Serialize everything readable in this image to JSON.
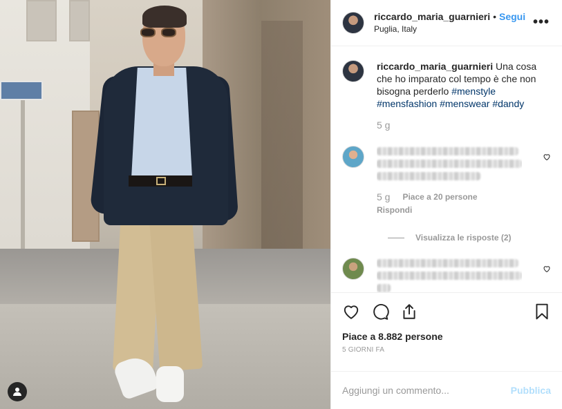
{
  "header": {
    "username": "riccardo_maria_guarnieri",
    "dot": "•",
    "follow_label": "Segui",
    "location": "Puglia, Italy",
    "more_label": "•••"
  },
  "caption": {
    "username": "riccardo_maria_guarnieri",
    "text": " Una cosa che ho imparato col tempo è che non bisogna perderlo ",
    "hashtags": [
      "#menstyle",
      "#mensfashion",
      "#menswear",
      "#dandy"
    ],
    "time": "5 g"
  },
  "comments": [
    {
      "time": "5 g",
      "likes": "Piace a 20 persone",
      "reply_label": "Rispondi",
      "view_replies": "Visualizza le risposte (2)"
    },
    {}
  ],
  "actions": {
    "like_icon": "heart-icon",
    "comment_icon": "comment-icon",
    "share_icon": "share-icon",
    "save_icon": "bookmark-icon"
  },
  "likes_text": "Piace a 8.882 persone",
  "posted_ago": "5 GIORNI FA",
  "add_comment": {
    "placeholder": "Aggiungi un commento...",
    "publish_label": "Pubblica"
  },
  "colors": {
    "accent": "#3897f0",
    "hashtag": "#003569",
    "muted": "#999999",
    "publish_disabled": "#b2dffc"
  }
}
